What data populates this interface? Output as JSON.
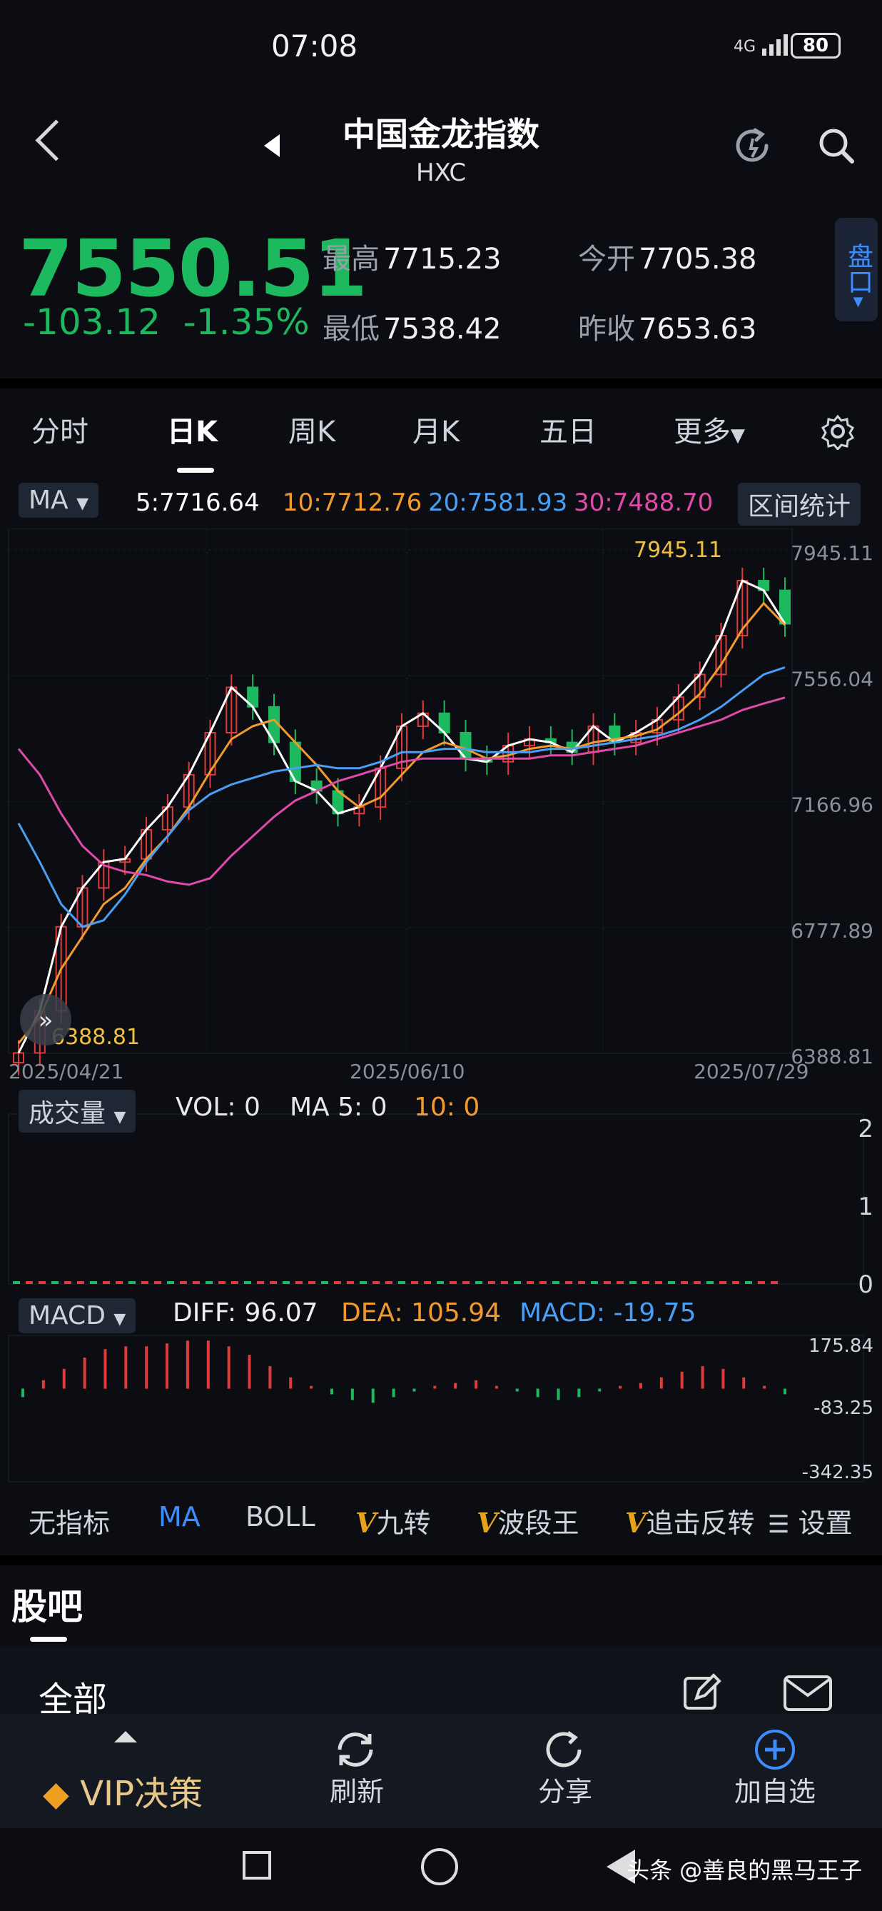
{
  "status": {
    "time": "07:08",
    "network": "4G",
    "battery": "80"
  },
  "header": {
    "title": "中国金龙指数",
    "code": "HXC"
  },
  "quote": {
    "price": "7550.51",
    "change": "-103.12",
    "change_pct": "-1.35%",
    "high_label": "最高",
    "high": "7715.23",
    "open_label": "今开",
    "open": "7705.38",
    "low_label": "最低",
    "low": "7538.42",
    "prev_close_label": "昨收",
    "prev_close": "7653.63",
    "pankou": "盘口"
  },
  "tabs": [
    "分时",
    "日K",
    "周K",
    "月K",
    "五日",
    "更多"
  ],
  "active_tab": "日K",
  "ma_row": {
    "selector": "MA",
    "ma5": "5:7716.64",
    "ma10": "10:7712.76",
    "ma20": "20:7581.93",
    "ma30": "30:7488.70",
    "range_stats": "区间统计"
  },
  "colors": {
    "up": "#e03b3b",
    "down": "#1db95f",
    "ma5": "#ffffff",
    "ma10": "#f29a2e",
    "ma20": "#4a9ff5",
    "ma30": "#e04aa8",
    "accent": "#3d8dff"
  },
  "chart_data": [
    {
      "type": "line",
      "y_ticks": [
        "7945.11",
        "7556.04",
        "7166.96",
        "6777.89",
        "6388.81"
      ],
      "ylim": [
        6388.81,
        7945.11
      ],
      "x_ticks": [
        "2025/04/21",
        "2025/06/10",
        "2025/07/29"
      ],
      "max_label": "7945.11",
      "min_label": "6388.81",
      "series": [
        {
          "name": "MA5",
          "values": [
            6390,
            6520,
            6780,
            6900,
            6980,
            6990,
            7080,
            7150,
            7250,
            7380,
            7520,
            7460,
            7350,
            7230,
            7200,
            7130,
            7150,
            7270,
            7400,
            7440,
            7380,
            7300,
            7290,
            7340,
            7360,
            7350,
            7320,
            7400,
            7350,
            7380,
            7420,
            7490,
            7560,
            7680,
            7850,
            7820,
            7716.64
          ]
        },
        {
          "name": "MA10",
          "values": [
            6420,
            6500,
            6650,
            6750,
            6850,
            6900,
            6990,
            7060,
            7150,
            7260,
            7360,
            7400,
            7420,
            7350,
            7280,
            7200,
            7150,
            7180,
            7250,
            7320,
            7350,
            7330,
            7300,
            7310,
            7330,
            7340,
            7330,
            7350,
            7360,
            7370,
            7390,
            7440,
            7500,
            7590,
            7700,
            7780,
            7712.76
          ]
        },
        {
          "name": "MA20",
          "values": [
            7100,
            6980,
            6850,
            6780,
            6800,
            6880,
            6980,
            7060,
            7140,
            7190,
            7220,
            7240,
            7260,
            7270,
            7280,
            7270,
            7270,
            7290,
            7320,
            7320,
            7330,
            7330,
            7320,
            7320,
            7320,
            7330,
            7330,
            7340,
            7350,
            7360,
            7370,
            7390,
            7420,
            7460,
            7510,
            7560,
            7581.93
          ]
        },
        {
          "name": "MA30",
          "values": [
            7330,
            7250,
            7130,
            7030,
            6970,
            6950,
            6940,
            6920,
            6910,
            6930,
            7000,
            7060,
            7120,
            7170,
            7200,
            7230,
            7250,
            7270,
            7290,
            7300,
            7300,
            7300,
            7300,
            7300,
            7300,
            7310,
            7310,
            7320,
            7330,
            7340,
            7360,
            7380,
            7400,
            7420,
            7450,
            7470,
            7488.7
          ]
        }
      ]
    },
    {
      "type": "bar",
      "title": "成交量",
      "legend": {
        "vol": "VOL: 0",
        "ma5": "MA 5: 0",
        "ma10": "10: 0"
      },
      "y_ticks": [
        "2",
        "1",
        "0"
      ],
      "ylim": [
        0,
        2
      ],
      "values": [
        0
      ]
    },
    {
      "type": "bar",
      "title": "MACD",
      "legend": {
        "diff": "DIFF: 96.07",
        "dea": "DEA: 105.94",
        "macd": "MACD: -19.75"
      },
      "y_ticks": [
        "175.84",
        "-83.25",
        "-342.35"
      ],
      "ylim": [
        -342.35,
        175.84
      ],
      "values": [
        -30,
        30,
        70,
        110,
        140,
        150,
        150,
        160,
        170,
        170,
        150,
        120,
        80,
        40,
        10,
        -20,
        -40,
        -50,
        -30,
        -10,
        10,
        20,
        30,
        10,
        -10,
        -30,
        -40,
        -30,
        -10,
        10,
        20,
        40,
        60,
        80,
        70,
        40,
        10,
        -19.75
      ]
    }
  ],
  "indicator_bar": [
    "无指标",
    "MA",
    "BOLL",
    "九转",
    "波段王",
    "追击反转",
    "设置"
  ],
  "indicator_v": "V",
  "guba": {
    "title": "股吧",
    "filter": "全部"
  },
  "bottom_bar": {
    "vip": "VIP决策",
    "refresh": "刷新",
    "share": "分享",
    "add": "加自选"
  },
  "watermark": "头条 @善良的黑马王子"
}
